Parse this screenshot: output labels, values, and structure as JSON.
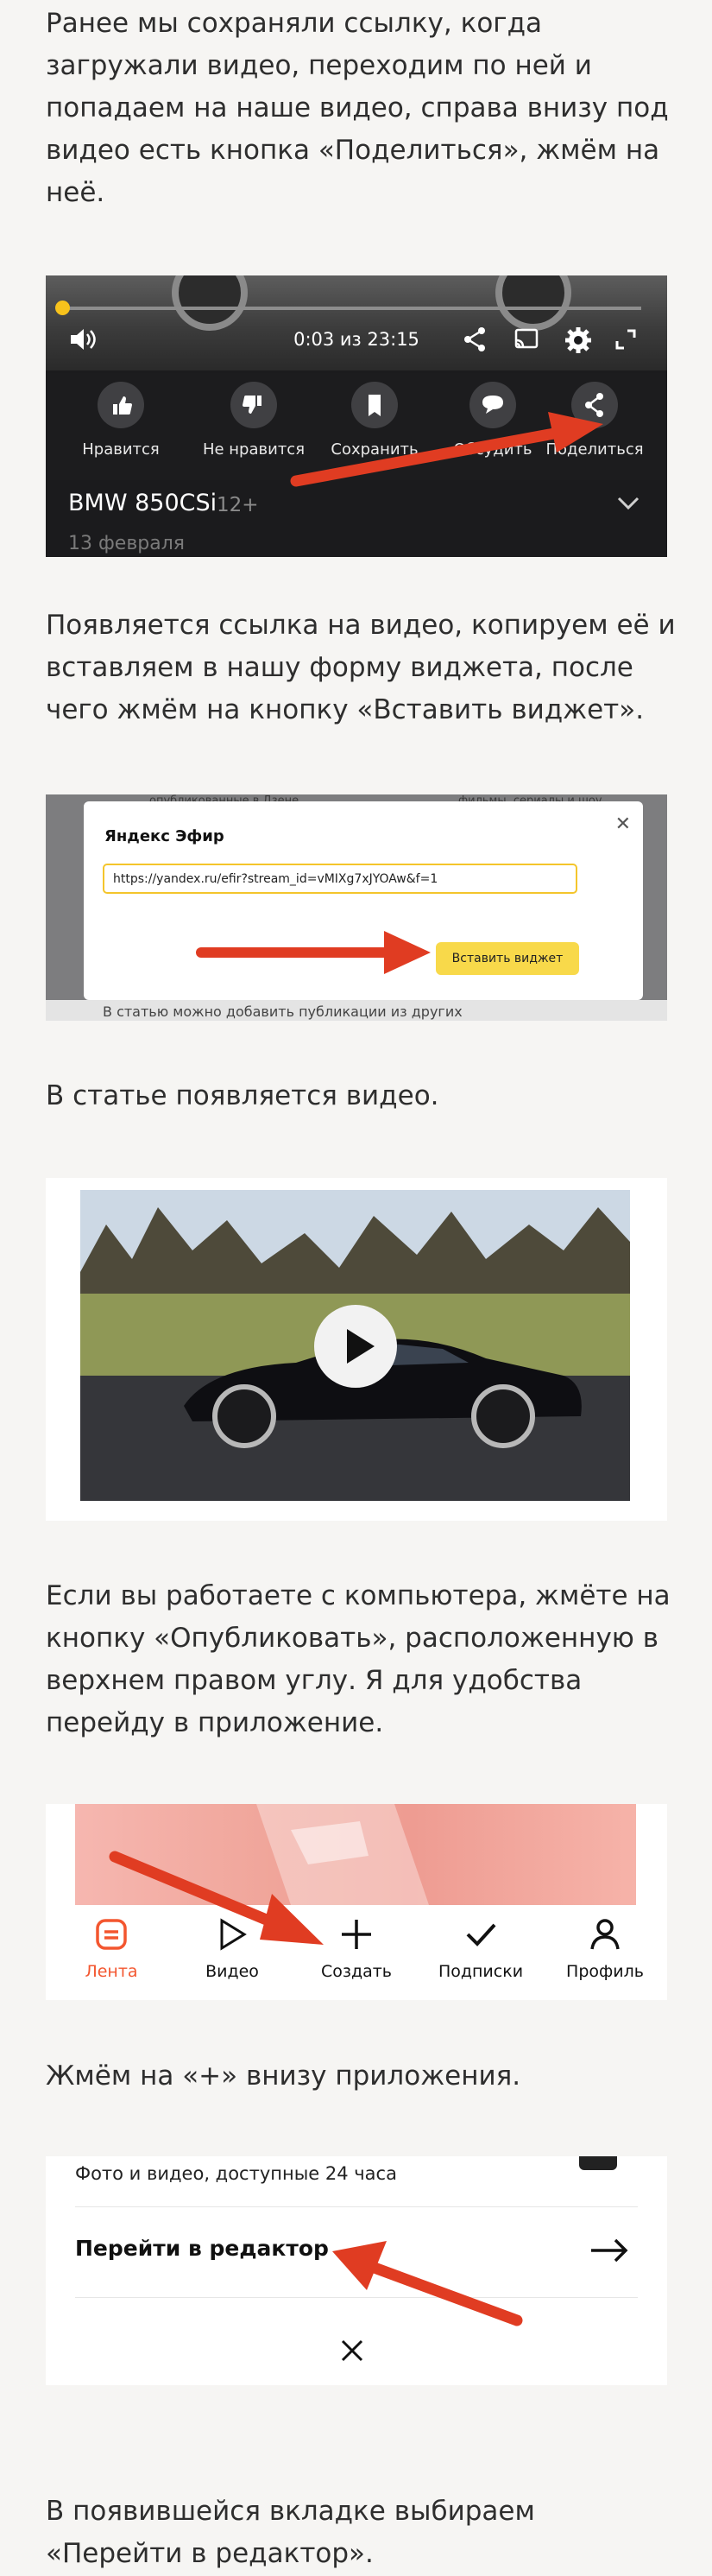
{
  "paragraphs": {
    "p1": [
      "Ранее мы сохраняли ссылку, когда",
      "загружали видео, переходим по ней и",
      "попадаем на наше видео, справа внизу под",
      "видео есть кнопка «Поделиться», жмём на",
      "неё."
    ],
    "p2": [
      "Появляется ссылка на видео, копируем её и",
      "вставляем в нашу форму виджета, после",
      "чего жмём на кнопку «Вставить виджет»."
    ],
    "p3": [
      "В статье появляется видео."
    ],
    "p4": [
      "Если вы работаете с компьютера, жмёте на",
      "кнопку «Опубликовать», расположенную в",
      "верхнем правом углу. Я для удобства",
      "перейду в приложение."
    ],
    "p5": [
      "Жмём на «+» внизу приложения."
    ],
    "p6": [
      "В появившейся вкладке выбираем",
      "«Перейти в редактор»."
    ]
  },
  "video_player": {
    "time": "0:03 из 23:15",
    "progress": 0.02,
    "actions": [
      "Нравится",
      "Не нравится",
      "Сохранить",
      "Обсудить",
      "Поделиться"
    ],
    "title": "BMW 850CSi",
    "age": "12+",
    "date": "13 февраля",
    "accent": "#f7c21c"
  },
  "widget_dialog": {
    "bg_left": "опубликованные в Дзене",
    "bg_right": "фильмы, сериалы и шоу",
    "title": "Яндекс Эфир",
    "url": "https://yandex.ru/efir?stream_id=vMIXg7xJYOAw&f=1",
    "insert_button": "Вставить виджет",
    "bottom_text": "В статью можно добавить публикации из других"
  },
  "bottom_nav": {
    "items": [
      "Лента",
      "Видео",
      "Создать",
      "Подписки",
      "Профиль"
    ],
    "active": "Лента",
    "active_color": "#f3562f"
  },
  "editor_sheet": {
    "row1": "Фото и видео, доступные 24 часа",
    "row2": "Перейти в редактор"
  },
  "arrow_color": "#e03c22"
}
